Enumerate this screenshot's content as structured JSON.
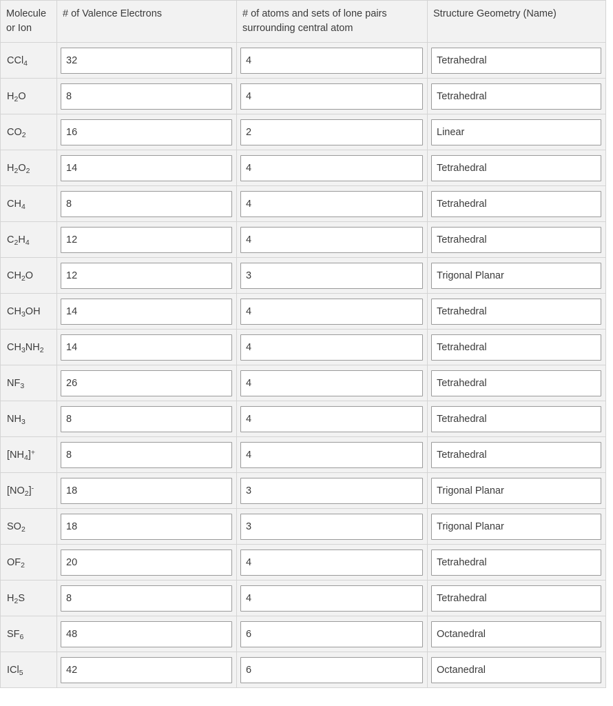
{
  "table": {
    "headers": [
      {
        "line1": "Molecule",
        "line2": "or Ion"
      },
      {
        "line1": "# of Valence Electrons",
        "line2": ""
      },
      {
        "line1": "# of atoms and sets of lone pairs",
        "line2": "surrounding central atom"
      },
      {
        "line1": "Structure Geometry (Name)",
        "line2": ""
      }
    ],
    "rows": [
      {
        "formula_html": "CCl<sub>4</sub>",
        "formula_text": "CCl4",
        "valence_electrons": "32",
        "atoms_and_lone_pairs": "4",
        "geometry": "Tetrahedral"
      },
      {
        "formula_html": "H<sub>2</sub>O",
        "formula_text": "H2O",
        "valence_electrons": "8",
        "atoms_and_lone_pairs": "4",
        "geometry": "Tetrahedral"
      },
      {
        "formula_html": "CO<sub>2</sub>",
        "formula_text": "CO2",
        "valence_electrons": "16",
        "atoms_and_lone_pairs": "2",
        "geometry": "Linear"
      },
      {
        "formula_html": "H<sub>2</sub>O<sub>2</sub>",
        "formula_text": "H2O2",
        "valence_electrons": "14",
        "atoms_and_lone_pairs": "4",
        "geometry": "Tetrahedral"
      },
      {
        "formula_html": "CH<sub>4</sub>",
        "formula_text": "CH4",
        "valence_electrons": "8",
        "atoms_and_lone_pairs": "4",
        "geometry": "Tetrahedral"
      },
      {
        "formula_html": "C<sub>2</sub>H<sub>4</sub>",
        "formula_text": "C2H4",
        "valence_electrons": "12",
        "atoms_and_lone_pairs": "4",
        "geometry": "Tetrahedral"
      },
      {
        "formula_html": "CH<sub>2</sub>O",
        "formula_text": "CH2O",
        "valence_electrons": "12",
        "atoms_and_lone_pairs": "3",
        "geometry": "Trigonal Planar"
      },
      {
        "formula_html": "CH<sub>3</sub>OH",
        "formula_text": "CH3OH",
        "valence_electrons": "14",
        "atoms_and_lone_pairs": "4",
        "geometry": "Tetrahedral"
      },
      {
        "formula_html": "CH<sub>3</sub>NH<sub>2</sub>",
        "formula_text": "CH3NH2",
        "valence_electrons": "14",
        "atoms_and_lone_pairs": "4",
        "geometry": "Tetrahedral"
      },
      {
        "formula_html": "NF<sub>3</sub>",
        "formula_text": "NF3",
        "valence_electrons": "26",
        "atoms_and_lone_pairs": "4",
        "geometry": "Tetrahedral"
      },
      {
        "formula_html": "NH<sub>3</sub>",
        "formula_text": "NH3",
        "valence_electrons": "8",
        "atoms_and_lone_pairs": "4",
        "geometry": "Tetrahedral"
      },
      {
        "formula_html": "[NH<sub>4</sub>]<sup>+</sup>",
        "formula_text": "[NH4]+",
        "valence_electrons": "8",
        "atoms_and_lone_pairs": "4",
        "geometry": "Tetrahedral"
      },
      {
        "formula_html": "[NO<sub>2</sub>]<sup>-</sup>",
        "formula_text": "[NO2]-",
        "valence_electrons": "18",
        "atoms_and_lone_pairs": "3",
        "geometry": "Trigonal Planar"
      },
      {
        "formula_html": "SO<sub>2</sub>",
        "formula_text": "SO2",
        "valence_electrons": "18",
        "atoms_and_lone_pairs": "3",
        "geometry": "Trigonal Planar"
      },
      {
        "formula_html": "OF<sub>2</sub>",
        "formula_text": "OF2",
        "valence_electrons": "20",
        "atoms_and_lone_pairs": "4",
        "geometry": "Tetrahedral"
      },
      {
        "formula_html": "H<sub>2</sub>S",
        "formula_text": "H2S",
        "valence_electrons": "8",
        "atoms_and_lone_pairs": "4",
        "geometry": "Tetrahedral"
      },
      {
        "formula_html": "SF<sub>6</sub>",
        "formula_text": "SF6",
        "valence_electrons": "48",
        "atoms_and_lone_pairs": "6",
        "geometry": "Octanedral"
      },
      {
        "formula_html": "ICl<sub>5</sub>",
        "formula_text": "ICl5",
        "valence_electrons": "42",
        "atoms_and_lone_pairs": "6",
        "geometry": "Octanedral"
      }
    ]
  },
  "colors": {
    "header_background": "#f2f2f2",
    "cell_background": "#f2f2f2",
    "field_background": "#ffffff",
    "border": "#d4d4d4",
    "field_border": "#9a9a9a",
    "text": "#3b3b3b"
  }
}
